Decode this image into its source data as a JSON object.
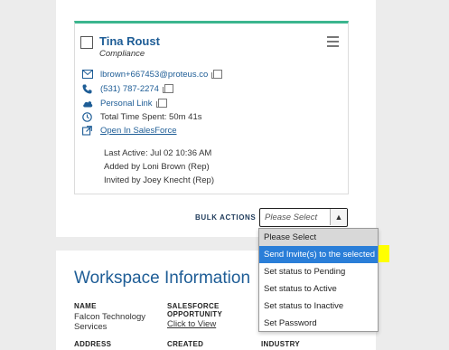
{
  "contact": {
    "name": "Tina Roust",
    "role": "Compliance",
    "email": "lbrown+667453@proteus.co",
    "phone": "(531) 787-2274",
    "personal_link": "Personal Link",
    "time_spent": "Total Time Spent: 50m 41s",
    "salesforce_link": "Open In SalesForce",
    "last_active": "Last Active: Jul 02 10:36 AM",
    "added_by": "Added by Loni Brown (Rep)",
    "invited_by": "Invited by Joey Knecht (Rep)"
  },
  "bulk": {
    "label": "BULK ACTIONS",
    "placeholder": "Please Select",
    "options": [
      "Please Select",
      "Send Invite(s) to the selected",
      "Set status to Pending",
      "Set status to Active",
      "Set status to Inactive",
      "Set Password"
    ]
  },
  "workspace": {
    "title": "Workspace Information",
    "name_label": "NAME",
    "name_value": "Falcon Technology Services",
    "opportunity_label": "SALESFORCE OPPORTUNITY",
    "opportunity_link": "Click to View",
    "address_label": "ADDRESS",
    "created_label": "CREATED",
    "industry_label": "INDUSTRY"
  },
  "colors": {
    "accent": "#3bb58e",
    "link": "#1e5d96",
    "selected": "#2a7ed8",
    "highlight": "#ffff00"
  }
}
